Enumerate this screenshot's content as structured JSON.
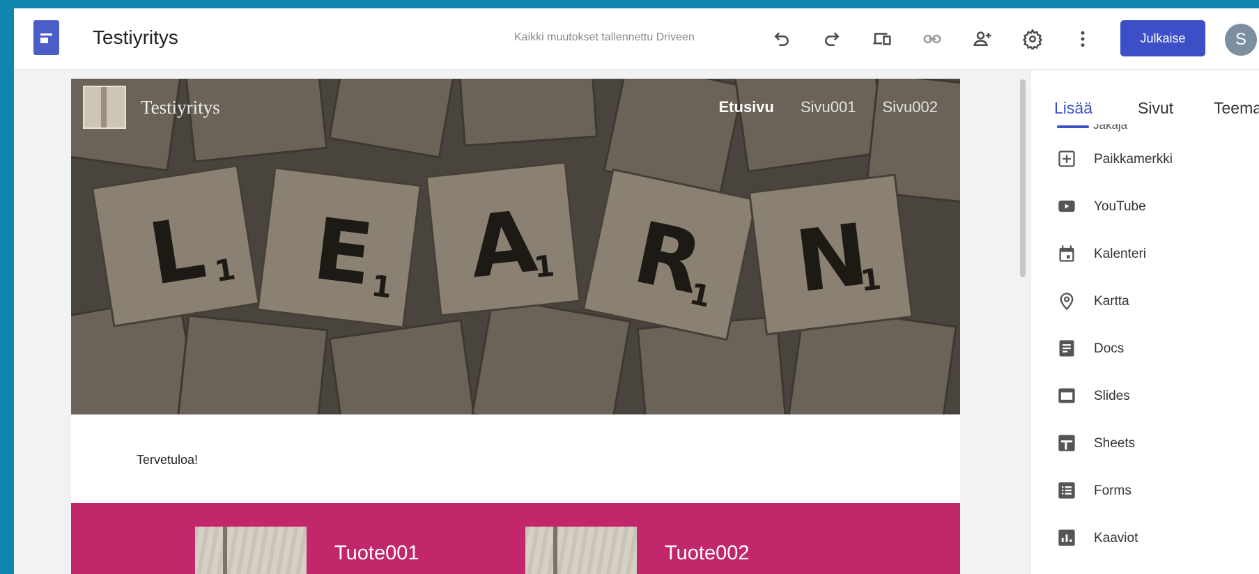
{
  "topbar": {
    "title": "Testiyritys",
    "save_status": "Kaikki muutokset tallennettu Driveen",
    "publish_label": "Julkaise",
    "avatar_initial": "S",
    "icons": [
      "undo-icon",
      "redo-icon",
      "preview-icon",
      "link-icon",
      "share-icon",
      "settings-icon",
      "more-icon"
    ]
  },
  "site": {
    "name": "Testiyritys",
    "nav": [
      "Etusivu",
      "Sivu001",
      "Sivu002"
    ],
    "active_nav": "Etusivu",
    "hero_tiles": [
      "L",
      "E",
      "A",
      "R",
      "N"
    ],
    "hero_subscript": "1",
    "welcome": "Tervetuloa!",
    "products": [
      "Tuote001",
      "Tuote002"
    ],
    "band_color": "#c2266b"
  },
  "panel": {
    "tabs": [
      "Lisää",
      "Sivut",
      "Teema"
    ],
    "active_tab": "Lisää",
    "cut_item": "Jakaja",
    "items": [
      {
        "label": "Paikkamerkki",
        "icon": "placeholder-icon"
      },
      {
        "label": "YouTube",
        "icon": "youtube-icon"
      },
      {
        "label": "Kalenteri",
        "icon": "calendar-icon"
      },
      {
        "label": "Kartta",
        "icon": "map-pin-icon"
      },
      {
        "label": "Docs",
        "icon": "docs-icon"
      },
      {
        "label": "Slides",
        "icon": "slides-icon"
      },
      {
        "label": "Sheets",
        "icon": "sheets-icon"
      },
      {
        "label": "Forms",
        "icon": "forms-icon"
      },
      {
        "label": "Kaaviot",
        "icon": "charts-icon"
      }
    ]
  },
  "colors": {
    "accent": "#3c4fc6",
    "frame": "#1184b0"
  }
}
